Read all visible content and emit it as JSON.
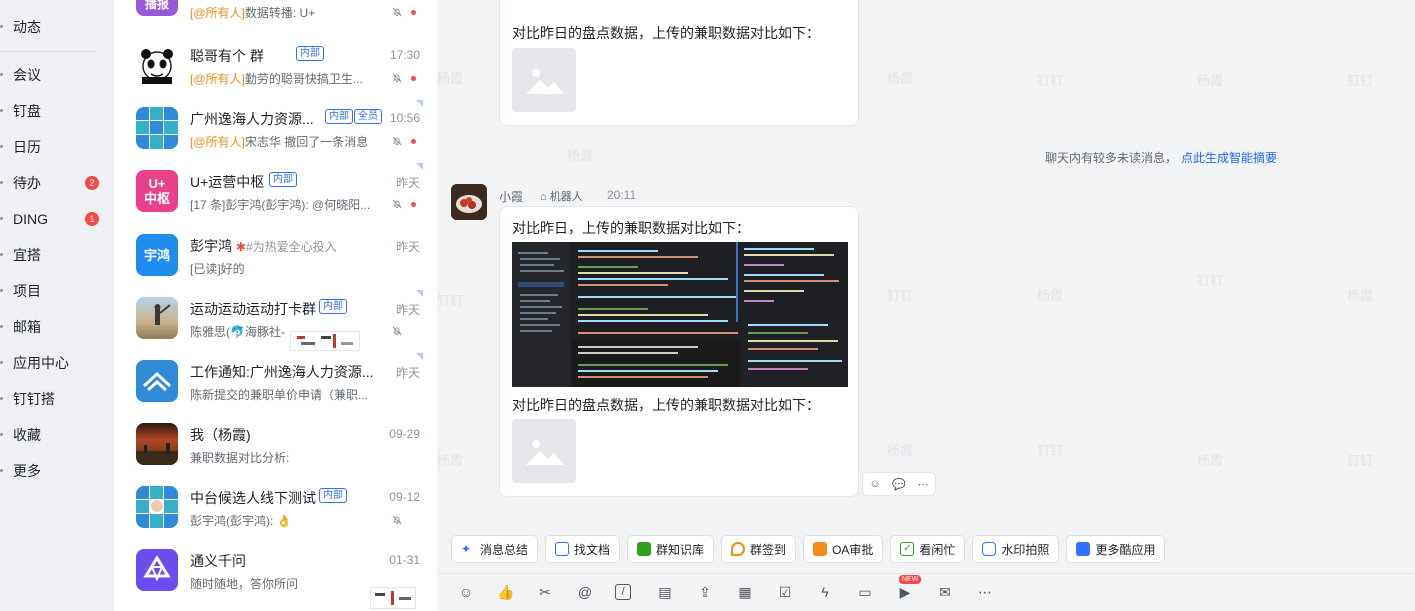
{
  "nav": {
    "items": [
      {
        "label": "动态"
      },
      {
        "label": "会议"
      },
      {
        "label": "钉盘"
      },
      {
        "label": "日历"
      },
      {
        "label": "待办",
        "badge": "2"
      },
      {
        "label": "DING",
        "badge": "1"
      },
      {
        "label": "宜搭"
      },
      {
        "label": "项目"
      },
      {
        "label": "邮箱"
      },
      {
        "label": "应用中心"
      },
      {
        "label": "钉钉搭"
      },
      {
        "label": "收藏"
      },
      {
        "label": "更多"
      }
    ]
  },
  "conversations": [
    {
      "avatar_text": "播报",
      "title": "",
      "tag": "",
      "time": "",
      "at": "[@所有人]",
      "preview": "数据转播: U+",
      "muted": true,
      "unread_dot": true
    },
    {
      "avatar_text": "",
      "title": "聪哥有个        群",
      "tag": "内部",
      "time": "17:30",
      "at": "[@所有人]",
      "preview": "勤劳的聪哥快搞卫生...",
      "muted": true,
      "unread_dot": true
    },
    {
      "avatar_text": "",
      "title": "广州逸海人力资源...",
      "tag": "内部",
      "tag2": "全员",
      "time": "10:56",
      "at": "[@所有人]",
      "preview": "宋志华 撤回了一条消息",
      "muted": true,
      "unread_dot": true
    },
    {
      "avatar_text": "U+\n中枢",
      "title": "U+运营中枢",
      "tag": "内部",
      "time": "昨天",
      "at": "",
      "preview": "[17 条]彭宇鸿(彭宇鸿): @何晓阳...",
      "muted": true,
      "unread_dot": true
    },
    {
      "avatar_text": "宇鸿",
      "title": "彭宇鸿",
      "status": "#为热爱全心投入",
      "tag": "",
      "time": "昨天",
      "at": "",
      "preview": "[已读]好的",
      "muted": false,
      "unread_dot": false
    },
    {
      "avatar_text": "",
      "title": "运动运动运动打卡群",
      "tag": "内部",
      "time": "昨天",
      "at": "",
      "preview": "陈雅思(🐬海豚社-",
      "muted": true,
      "unread_dot": false
    },
    {
      "avatar_text": "",
      "title": "工作通知:广州逸海人力资源...",
      "tag": "",
      "time": "昨天",
      "at": "",
      "preview": "陈新提交的兼职单价申请（兼职...",
      "muted": false,
      "unread_dot": false
    },
    {
      "avatar_text": "",
      "title": "我（杨霞)",
      "tag": "",
      "time": "09-29",
      "at": "",
      "preview": "兼职数据对比分析:",
      "muted": false,
      "unread_dot": false
    },
    {
      "avatar_text": "",
      "title": "中台候选人线下测试",
      "tag": "内部",
      "time": "09-12",
      "at": "",
      "preview": "彭宇鸿(彭宇鸿): 👌",
      "muted": true,
      "unread_dot": false
    },
    {
      "avatar_text": "",
      "title": "通义千问",
      "tag": "",
      "time": "01-31",
      "at": "",
      "preview": "随时随地，答你所问",
      "muted": true,
      "unread_dot": false
    }
  ],
  "chat": {
    "watermark": "杨霞",
    "watermark2": "钉钉",
    "msg1": {
      "text": "对比昨日的盘点数据，上传的兼职数据对比如下："
    },
    "summary_tip": "聊天内有较多未读消息，",
    "summary_link": "点此生成智能摘要",
    "msg2": {
      "sender": "小霞",
      "bot_tag": "机器人",
      "time": "20:11",
      "text1": "对比昨日，上传的兼职数据对比如下：",
      "text2": "对比昨日的盘点数据，上传的兼职数据对比如下："
    }
  },
  "quick_apps": [
    {
      "label": "消息总结",
      "color": "#3370ff"
    },
    {
      "label": "找文档",
      "color": "#3370ff"
    },
    {
      "label": "群知识库",
      "color": "#2ea121"
    },
    {
      "label": "群签到",
      "color": "#f58c1c"
    },
    {
      "label": "OA审批",
      "color": "#f58c1c"
    },
    {
      "label": "看闲忙",
      "color": "#2ea121"
    },
    {
      "label": "水印拍照",
      "color": "#3370ff"
    },
    {
      "label": "更多酷应用",
      "color": "#3370ff"
    }
  ],
  "toolbar": {
    "new_badge": "NEW",
    "icons": [
      "emoji-icon",
      "thumbs-up-icon",
      "scissors-icon",
      "at-icon",
      "slash-command-icon",
      "doc-icon",
      "folder-upload-icon",
      "calendar-icon",
      "checkbox-icon",
      "ding-lightning-icon",
      "video-icon",
      "live-icon",
      "mail-icon",
      "more-icon"
    ]
  }
}
